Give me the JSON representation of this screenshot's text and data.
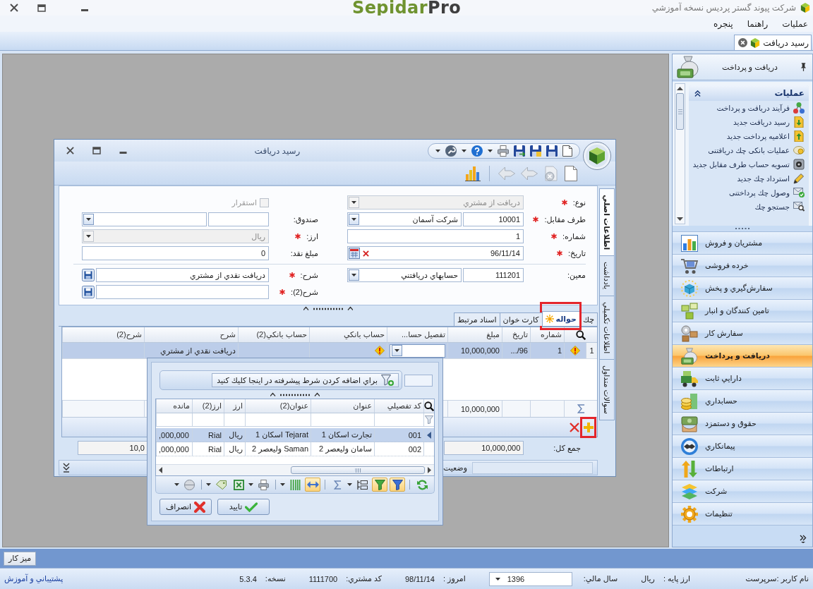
{
  "window": {
    "title": "شرکت پیوند گستر پردیس نسخه آموزشي",
    "logo": {
      "primary": "Sepidar",
      "secondary": "Pro"
    }
  },
  "menu": [
    {
      "label": "عمليات"
    },
    {
      "label": "راهنما"
    },
    {
      "label": "پنجره"
    }
  ],
  "doc_tabs": [
    {
      "label": "رسید دریافت",
      "selected": true
    }
  ],
  "sidebar": {
    "title": "دريافت و پرداخت",
    "section": {
      "title": "عمليات",
      "expanded": true,
      "items": [
        {
          "label": "فرآیند دریافت و پرداخت"
        },
        {
          "label": "رسید دریافت جدید"
        },
        {
          "label": "اعلامیه پرداخت جدید"
        },
        {
          "label": "عملیات بانکی چك دریافتنی"
        },
        {
          "label": "تسویه حساب طرف مقابل جدید"
        },
        {
          "label": "استرداد چك جدید"
        },
        {
          "label": "وصول چك پرداختنی"
        },
        {
          "label": "جستجو چك"
        }
      ]
    },
    "modules": [
      {
        "label": "مشتریان و فروش",
        "selected": false
      },
      {
        "label": "خرده فروشی",
        "selected": false
      },
      {
        "label": "سفارش‌گيري و پخش",
        "selected": false
      },
      {
        "label": "تامین کنندگان و انبار",
        "selected": false
      },
      {
        "label": "سفارش کار",
        "selected": false
      },
      {
        "label": "دریافت و پرداخت",
        "selected": true
      },
      {
        "label": "دارايي ثابت",
        "selected": false
      },
      {
        "label": "حسابداري",
        "selected": false
      },
      {
        "label": "حقوق و دستمزد",
        "selected": false
      },
      {
        "label": "پيمانكاري",
        "selected": false
      },
      {
        "label": "ارتباطات",
        "selected": false
      },
      {
        "label": "شرکت",
        "selected": false
      },
      {
        "label": "تنظیمات",
        "selected": false
      }
    ]
  },
  "dialog": {
    "title": "رسید دریافت",
    "side_tabs": [
      {
        "label": "اطلاعات اصلي",
        "selected": true
      },
      {
        "label": "يادداشت",
        "selected": false
      },
      {
        "label": "اطلاعات تكميلي",
        "selected": false
      },
      {
        "label": "سوالات متداول",
        "selected": false
      }
    ],
    "form": [
      [
        {
          "right": {
            "kind": "dropdown",
            "label": "نوع:",
            "required": true,
            "disabled": true,
            "value": "دریافت از مشتري"
          },
          "left": {
            "kind": "checkbox",
            "label": "استقرار",
            "checked": false,
            "disabled": true
          }
        },
        {
          "right": {
            "kind": "lookup",
            "label": "طرف مقابل:",
            "required": true,
            "disabled": false,
            "code": "10001",
            "value": "شرکت آسمان"
          },
          "left": {
            "kind": "lookup",
            "label": "صندوق:",
            "required": false,
            "disabled": false
          }
        },
        {
          "right": {
            "kind": "text",
            "label": "شماره:",
            "required": true,
            "disabled": false,
            "value": "1"
          },
          "left": {
            "kind": "dropdown",
            "label": "ارز:",
            "required": true,
            "disabled": true,
            "value": "ريال"
          }
        },
        {
          "right": {
            "kind": "date",
            "label": "تاریخ:",
            "required": true,
            "disabled": false,
            "value": "96/11/14"
          },
          "left": {
            "kind": "text",
            "label": "مبلغ نقد:",
            "required": false,
            "disabled": false,
            "value": "0"
          }
        }
      ],
      [
        {
          "right": {
            "kind": "lookup",
            "label": "معین:",
            "required": false,
            "disabled": false,
            "code": "111201",
            "value": "حسابهاي دریافتني"
          },
          "left": {
            "kind": "memo",
            "label": "شرح:",
            "required": true,
            "disabled": false,
            "value": "دريافت نقدي از مشتري"
          }
        },
        {
          "left": {
            "kind": "memo",
            "label": "شرح(2):",
            "required": true,
            "disabled": false
          }
        }
      ]
    ],
    "grid_tabs": [
      {
        "label": "چك",
        "selected": false,
        "highlighted": false
      },
      {
        "label": "حواله",
        "selected": true,
        "highlighted": true
      },
      {
        "label": "كارت خوان",
        "selected": false,
        "highlighted": false
      },
      {
        "label": "اسناد مرتبط",
        "selected": false,
        "highlighted": false
      }
    ],
    "grid": {
      "columns": [
        "شماره",
        "تاريخ",
        "مبلغ",
        "تفصيل حسا...",
        "حساب بانكي",
        "حساب بانكي(2)",
        "شرح",
        "شرح(2)"
      ],
      "rows": [
        {
          "index": "1",
          "selected": true,
          "warning": true,
          "editing": true,
          "cells": {
            "number": "1",
            "date": "96/...",
            "amount": "10,000,000",
            "description": "دريافت نقدي از مشتري"
          }
        }
      ],
      "totals": {
        "amount": "10,000,000"
      },
      "actions": [
        {
          "kind": "add",
          "highlighted": true
        },
        {
          "kind": "delete",
          "highlighted": false
        }
      ]
    },
    "grand_total": {
      "label": "جمع كل:",
      "value": "10,000,000",
      "value_2": "10,0"
    },
    "status": {
      "label": "وضعيت"
    }
  },
  "lookup": {
    "filter_hint": "براي اضافه كردن شرط پيشرفته در اینجا كليك كنيد",
    "columns": [
      "كد تفصيلي",
      "عنوان",
      "عنوان(2)",
      "ارز",
      "ارز(2)",
      "مانده"
    ],
    "rows": [
      {
        "selected": true,
        "cells": [
          "001",
          "تجارت اسكان 1",
          "Tejarat اسكان 1",
          "ريال",
          "Rial",
          ",000,000"
        ]
      },
      {
        "selected": false,
        "cells": [
          "002",
          "سامان وليعصر 2",
          "Saman وليعصر 2",
          "ريال",
          "Rial",
          ",000,000"
        ]
      }
    ],
    "toolbar": [
      {
        "kind": "refresh",
        "pressed": false,
        "menu": false
      },
      {
        "kind": "separator"
      },
      {
        "kind": "filter",
        "pressed": true,
        "menu": false
      },
      {
        "kind": "filter_row",
        "pressed": true,
        "menu": false
      },
      {
        "kind": "group",
        "pressed": false,
        "menu": true
      },
      {
        "kind": "sum",
        "pressed": false,
        "menu": false
      },
      {
        "kind": "separator"
      },
      {
        "kind": "fit",
        "pressed": true,
        "menu": false
      },
      {
        "kind": "columns",
        "pressed": false,
        "menu": true
      },
      {
        "kind": "separator"
      },
      {
        "kind": "print",
        "pressed": false,
        "menu": true
      },
      {
        "kind": "excel",
        "pressed": false,
        "menu": false
      },
      {
        "kind": "export",
        "pressed": false,
        "menu": true
      },
      {
        "kind": "separator"
      },
      {
        "kind": "layout",
        "pressed": false,
        "menu": true
      }
    ],
    "buttons": [
      {
        "kind": "ok",
        "label": "تاييد"
      },
      {
        "kind": "cancel",
        "label": "انصراف"
      }
    ]
  },
  "taskbar": {
    "buttons": [
      {
        "label": "ميز كار"
      }
    ]
  },
  "status_bar": {
    "user": "نام کاربر :سرپرست",
    "fields": [
      {
        "kind": "text",
        "label": "ارز پايه :",
        "value": "ريال"
      },
      {
        "kind": "dropdown",
        "label": "سال مالي:",
        "value": "1396"
      },
      {
        "kind": "text",
        "label": "امروز :",
        "value": "98/11/14"
      },
      {
        "kind": "text",
        "label": "كد مشتري:",
        "value": "1111700"
      },
      {
        "kind": "text",
        "label": "نسخه:",
        "value": "5.3.4"
      }
    ],
    "link": "پشتيباني و آموزش"
  }
}
